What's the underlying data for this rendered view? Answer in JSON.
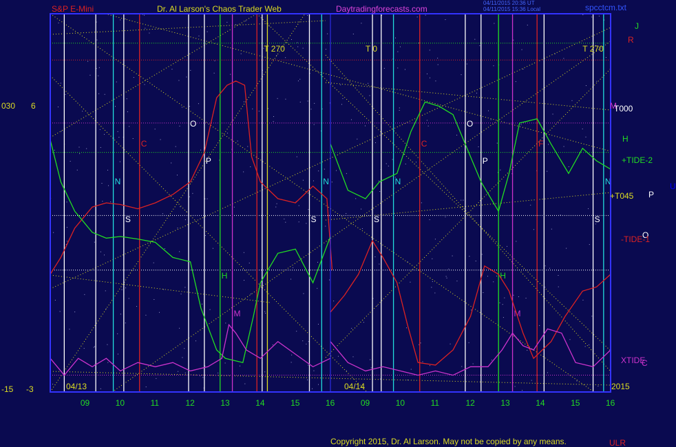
{
  "header": {
    "left_title": "S&P E-Mini",
    "center_title": "Dr. Al Larson's Chaos Trader Web",
    "site": "Daytradingforecasts.com",
    "timestamp_ut": "04/11/2015 20:36 UT",
    "timestamp_local": "04/11/2015 15:36 Local",
    "file": "spcctcm.txt"
  },
  "footer": {
    "copyright": "Copyright 2015, Dr. Al Larson. May not be copied by any means.",
    "corner_tag": "ULR"
  },
  "colors": {
    "background": "#0a0a50",
    "plot_border": "#3333ff",
    "price": "#dd1111",
    "green": "#22dd22",
    "xtide": "#dd44dd",
    "yellow": "#dddd22",
    "white": "#ffffff",
    "cyan": "#22dddd",
    "red": "#dd2222",
    "magenta": "#cc33cc"
  },
  "chart_data": {
    "type": "line",
    "x_date_labels": [
      "04/13",
      "04/14"
    ],
    "x_ticks": [
      "09",
      "10",
      "11",
      "12",
      "13",
      "14",
      "15",
      "16",
      "09",
      "10",
      "11",
      "12",
      "13",
      "14",
      "15",
      "16"
    ],
    "year": "2015",
    "left_axis": {
      "top_outer": "030",
      "top_inner": "6",
      "bottom_outer": "-15",
      "bottom_inner": "-3"
    },
    "panel_markers": [
      {
        "day": "04/13",
        "hour": 14.1,
        "label": "T",
        "value": "270"
      },
      {
        "day": "04/14",
        "hour": 9.0,
        "label": "T",
        "value": "0"
      },
      {
        "day": "04/14",
        "hour": 15.2,
        "label": "T",
        "value": "270"
      }
    ],
    "right_labels": [
      {
        "text": "J",
        "color": "green"
      },
      {
        "text": "R",
        "color": "red"
      },
      {
        "text": "M",
        "color": "magenta"
      },
      {
        "text": "T000",
        "color": "white"
      },
      {
        "text": "H",
        "color": "green"
      },
      {
        "text": "+TIDE-2",
        "color": "green"
      },
      {
        "text": "U",
        "color": "blue"
      },
      {
        "text": "+T045",
        "color": "yellow"
      },
      {
        "text": "P",
        "color": "white"
      },
      {
        "text": "O",
        "color": "white"
      },
      {
        "text": "-TIDE-1",
        "color": "red"
      },
      {
        "text": "XTIDE",
        "color": "magenta"
      },
      {
        "text": "C",
        "color": "magenta"
      }
    ],
    "vertical_lines": [
      {
        "day": "04/13",
        "hour": 8.4,
        "color": "white"
      },
      {
        "day": "04/13",
        "hour": 9.3,
        "color": "white"
      },
      {
        "day": "04/13",
        "hour": 9.8,
        "color": "cyan",
        "label": "N"
      },
      {
        "day": "04/13",
        "hour": 10.1,
        "color": "white",
        "label": "S"
      },
      {
        "day": "04/13",
        "hour": 10.55,
        "color": "red",
        "label": "C"
      },
      {
        "day": "04/13",
        "hour": 11.95,
        "color": "white",
        "label": "O"
      },
      {
        "day": "04/13",
        "hour": 12.4,
        "color": "white",
        "label": "P"
      },
      {
        "day": "04/13",
        "hour": 12.85,
        "color": "green",
        "label": "H"
      },
      {
        "day": "04/13",
        "hour": 13.2,
        "color": "magenta",
        "label": "M"
      },
      {
        "day": "04/13",
        "hour": 13.9,
        "color": "red"
      },
      {
        "day": "04/13",
        "hour": 14.05,
        "color": "white"
      },
      {
        "day": "04/13",
        "hour": 14.2,
        "color": "yellow"
      },
      {
        "day": "04/13",
        "hour": 15.4,
        "color": "white",
        "label": "S"
      },
      {
        "day": "04/13",
        "hour": 15.75,
        "color": "cyan",
        "label": "N"
      },
      {
        "day": "04/14",
        "hour": 9.2,
        "color": "white",
        "label": "S"
      },
      {
        "day": "04/14",
        "hour": 9.45,
        "color": "white"
      },
      {
        "day": "04/14",
        "hour": 9.8,
        "color": "cyan",
        "label": "N"
      },
      {
        "day": "04/14",
        "hour": 10.55,
        "color": "red",
        "label": "C"
      },
      {
        "day": "04/14",
        "hour": 11.85,
        "color": "white",
        "label": "O"
      },
      {
        "day": "04/14",
        "hour": 12.3,
        "color": "white",
        "label": "P"
      },
      {
        "day": "04/14",
        "hour": 12.8,
        "color": "green",
        "label": "H"
      },
      {
        "day": "04/14",
        "hour": 13.2,
        "color": "magenta",
        "label": "M"
      },
      {
        "day": "04/14",
        "hour": 13.9,
        "color": "red",
        "label": "F"
      },
      {
        "day": "04/14",
        "hour": 14.1,
        "color": "white"
      },
      {
        "day": "04/14",
        "hour": 15.5,
        "color": "white",
        "label": "S"
      },
      {
        "day": "04/14",
        "hour": 15.8,
        "color": "cyan",
        "label": "N"
      }
    ],
    "horizontal_levels": [
      {
        "y": 26.5,
        "color": "green",
        "style": "dotted"
      },
      {
        "y": 24.5,
        "color": "red",
        "style": "dotted"
      },
      {
        "y": 17.0,
        "color": "magenta",
        "style": "dotted"
      },
      {
        "y": 13.5,
        "color": "green",
        "style": "dotted"
      },
      {
        "y": 6.0,
        "color": "white",
        "style": "dotted"
      },
      {
        "y": -0.5,
        "color": "white",
        "style": "dotted"
      },
      {
        "y": -13.0,
        "color": "magenta",
        "style": "dotted"
      }
    ],
    "series": [
      {
        "name": "price",
        "color": "red",
        "day1": [
          [
            8,
            -1
          ],
          [
            8.3,
            1
          ],
          [
            8.7,
            4.5
          ],
          [
            9.2,
            7
          ],
          [
            9.6,
            7.5
          ],
          [
            10,
            7.3
          ],
          [
            10.5,
            6.8
          ],
          [
            11,
            7.5
          ],
          [
            11.5,
            8.5
          ],
          [
            12,
            10
          ],
          [
            12.4,
            13.5
          ],
          [
            12.75,
            20
          ],
          [
            13.05,
            21.5
          ],
          [
            13.3,
            22
          ],
          [
            13.55,
            21.5
          ],
          [
            13.75,
            13
          ],
          [
            14,
            10
          ],
          [
            14.5,
            8
          ],
          [
            15,
            7.5
          ],
          [
            15.5,
            9.5
          ],
          [
            15.9,
            8
          ],
          [
            16.05,
            -0.5
          ]
        ],
        "day2": [
          [
            8,
            -5.5
          ],
          [
            8.4,
            -3.5
          ],
          [
            8.8,
            -1
          ],
          [
            9.2,
            3
          ],
          [
            9.5,
            1
          ],
          [
            9.9,
            -2
          ],
          [
            10.2,
            -7
          ],
          [
            10.5,
            -11.5
          ],
          [
            11,
            -11.8
          ],
          [
            11.5,
            -10
          ],
          [
            12,
            -6
          ],
          [
            12.4,
            0
          ],
          [
            12.8,
            -1
          ],
          [
            13.1,
            -3
          ],
          [
            13.5,
            -8
          ],
          [
            13.8,
            -11
          ],
          [
            14.3,
            -9
          ],
          [
            14.7,
            -6
          ],
          [
            15.2,
            -3
          ],
          [
            15.6,
            -2.5
          ],
          [
            16,
            -1
          ]
        ]
      },
      {
        "name": "",
        "color": "green",
        "day1": [
          [
            8,
            15
          ],
          [
            8.3,
            10
          ],
          [
            8.7,
            6.5
          ],
          [
            9.2,
            4
          ],
          [
            9.6,
            3.3
          ],
          [
            10,
            3.5
          ],
          [
            10.5,
            3.2
          ],
          [
            11,
            2.8
          ],
          [
            11.5,
            1
          ],
          [
            12,
            0.5
          ],
          [
            12.3,
            -5
          ],
          [
            12.75,
            -10
          ],
          [
            13,
            -11
          ],
          [
            13.5,
            -11.5
          ],
          [
            13.8,
            -6
          ],
          [
            14,
            -2
          ],
          [
            14.5,
            1.5
          ],
          [
            15,
            2
          ],
          [
            15.5,
            -2
          ],
          [
            16,
            3.5
          ]
        ],
        "day2": [
          [
            8,
            14.5
          ],
          [
            8.5,
            9
          ],
          [
            9,
            8
          ],
          [
            9.4,
            10
          ],
          [
            9.9,
            11
          ],
          [
            10.3,
            16
          ],
          [
            10.7,
            19.5
          ],
          [
            11.1,
            19
          ],
          [
            11.5,
            18
          ],
          [
            11.9,
            14
          ],
          [
            12.3,
            10
          ],
          [
            12.8,
            6.5
          ],
          [
            13.1,
            11
          ],
          [
            13.4,
            17
          ],
          [
            13.9,
            17.5
          ],
          [
            14.3,
            14.5
          ],
          [
            14.8,
            11
          ],
          [
            15.2,
            14
          ],
          [
            15.6,
            12.5
          ],
          [
            16,
            11.5
          ]
        ]
      },
      {
        "name": "",
        "color": "magenta",
        "day1": [
          [
            8,
            -11
          ],
          [
            8.4,
            -13
          ],
          [
            8.8,
            -11
          ],
          [
            9.2,
            -12
          ],
          [
            9.6,
            -11
          ],
          [
            10,
            -12.5
          ],
          [
            10.5,
            -11.5
          ],
          [
            11,
            -12
          ],
          [
            11.5,
            -11.5
          ],
          [
            12,
            -12.5
          ],
          [
            12.5,
            -12
          ],
          [
            12.9,
            -11
          ],
          [
            13.1,
            -7
          ],
          [
            13.3,
            -8
          ],
          [
            13.6,
            -10
          ],
          [
            14,
            -11
          ],
          [
            14.5,
            -9
          ],
          [
            15,
            -10.5
          ],
          [
            15.5,
            -12
          ],
          [
            16,
            -11
          ]
        ],
        "day2": [
          [
            8,
            -9
          ],
          [
            8.5,
            -11.5
          ],
          [
            9,
            -12.5
          ],
          [
            9.5,
            -12
          ],
          [
            10,
            -12.5
          ],
          [
            10.5,
            -13
          ],
          [
            11,
            -12.5
          ],
          [
            11.5,
            -13
          ],
          [
            12,
            -12
          ],
          [
            12.5,
            -12
          ],
          [
            12.9,
            -10
          ],
          [
            13.2,
            -8
          ],
          [
            13.5,
            -9.5
          ],
          [
            13.8,
            -10
          ],
          [
            14.2,
            -7.5
          ],
          [
            14.6,
            -8
          ],
          [
            15,
            -11.5
          ],
          [
            15.5,
            -12
          ],
          [
            16,
            -10
          ]
        ]
      }
    ],
    "y_range": [
      -15,
      30
    ]
  }
}
